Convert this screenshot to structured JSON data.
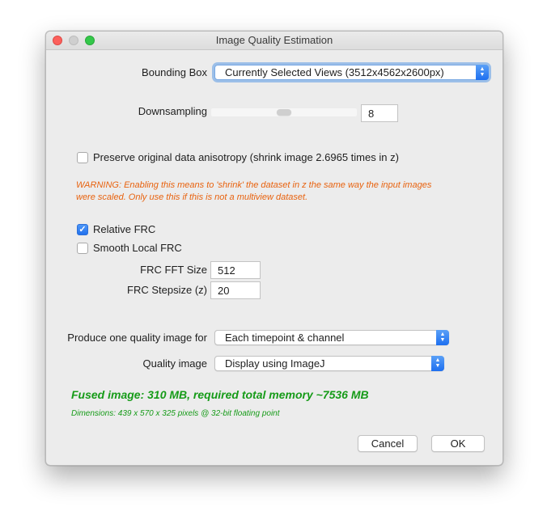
{
  "window": {
    "title": "Image Quality Estimation"
  },
  "bounding_box": {
    "label": "Bounding Box",
    "value": "Currently Selected Views (3512x4562x2600px)"
  },
  "downsampling": {
    "label": "Downsampling",
    "value": "8",
    "slider_level": 0.5
  },
  "anisotropy": {
    "label": "Preserve original data anisotropy (shrink image 2.6965 times in z)",
    "checked": false,
    "warning": "WARNING: Enabling this means to 'shrink' the dataset in z the same way the input images were scaled. Only use this if this is not a multiview dataset."
  },
  "relative_frc": {
    "label": "Relative FRC",
    "checked": true
  },
  "smooth_local_frc": {
    "label": "Smooth Local FRC",
    "checked": false
  },
  "frc_fft_size": {
    "label": "FRC FFT Size",
    "value": "512"
  },
  "frc_stepsize": {
    "label": "FRC Stepsize (z)",
    "value": "20"
  },
  "produce": {
    "label": "Produce one quality image for",
    "value": "Each timepoint & channel"
  },
  "quality_image": {
    "label": "Quality image",
    "value": "Display using ImageJ"
  },
  "memory": {
    "summary": "Fused image: 310 MB, required total memory ~7536 MB",
    "dimensions": "Dimensions: 439 x 570 x 325 pixels @ 32-bit floating point"
  },
  "buttons": {
    "cancel": "Cancel",
    "ok": "OK"
  },
  "colors": {
    "warning": "#e8620e",
    "info": "#169b18",
    "accent": "#2271ed"
  }
}
